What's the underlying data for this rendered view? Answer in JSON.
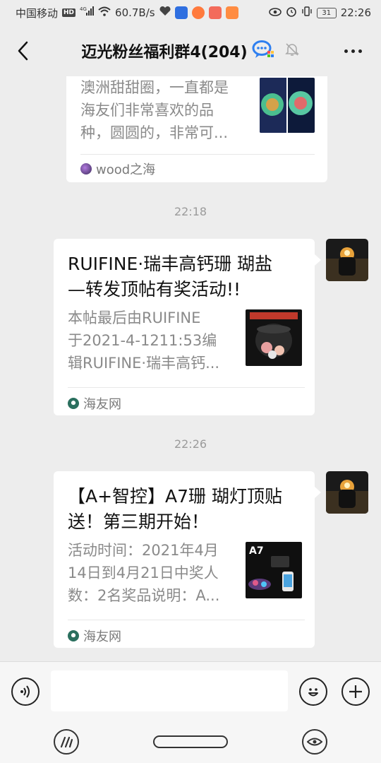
{
  "status_bar": {
    "carrier": "中国移动",
    "hd": "HD",
    "network": "4G",
    "speed": "60.7B/s",
    "battery": "31",
    "time": "22:26"
  },
  "header": {
    "title": "迈光粉丝福利群4(204)"
  },
  "messages": [
    {
      "type": "card",
      "desc": [
        "澳洲甜甜圈，一直都是",
        "海友们非常喜欢的品",
        "种，圆圆的，非常可..."
      ],
      "source": "wood之海"
    },
    {
      "type": "time",
      "text": "22:18"
    },
    {
      "type": "card",
      "title": [
        "RUIFINE·瑞丰高钙珊 瑚盐",
        "—转发顶帖有奖活动!!"
      ],
      "desc": [
        "本帖最后由RUIFINE",
        "于2021-4-1211:53编",
        "辑RUIFINE·瑞丰高钙..."
      ],
      "source": "海友网"
    },
    {
      "type": "time",
      "text": "22:26"
    },
    {
      "type": "card",
      "title": [
        "【A+智控】A7珊 瑚灯顶贴",
        "送！第三期开始！"
      ],
      "desc": [
        "活动时间：2021年4月",
        "14日到4月21日中奖人",
        "数：2名奖品说明：A..."
      ],
      "thumb_label": "A7",
      "source": "海友网"
    }
  ],
  "input": {
    "value": "",
    "placeholder": ""
  },
  "colors": {
    "background": "#ededed",
    "bubble": "#ffffff",
    "desc_text": "#8a8a8a",
    "source_text": "#7a7a7a"
  },
  "icons": [
    "back-arrow-icon",
    "chat-bot-icon",
    "mute-bell-icon",
    "more-icon",
    "voice-icon",
    "emoji-icon",
    "add-icon"
  ]
}
